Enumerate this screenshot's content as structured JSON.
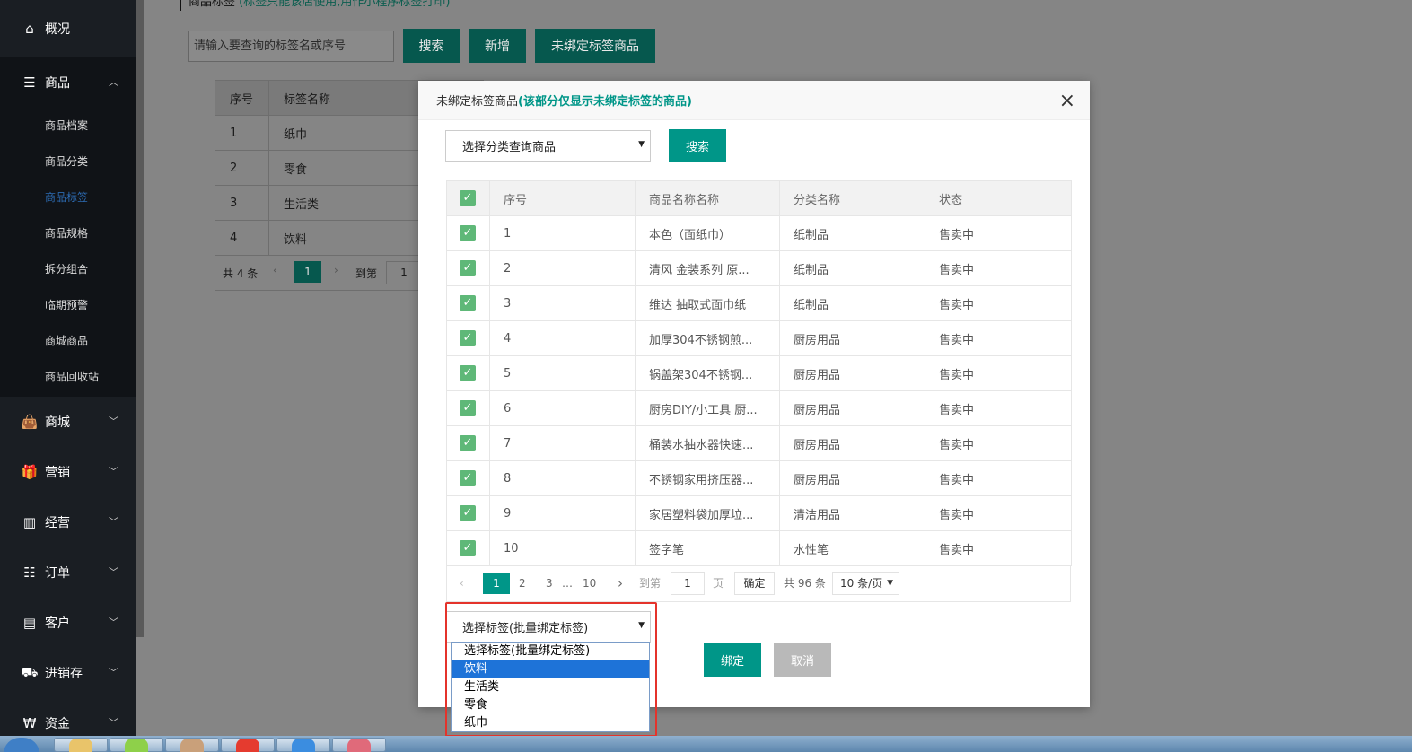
{
  "sidebar": {
    "top": {
      "label": "概况",
      "icon": "home-icon"
    },
    "product": {
      "label": "商品",
      "icon": "menu-icon"
    },
    "product_sub": [
      "商品档案",
      "商品分类",
      "商品标签",
      "商品规格",
      "拆分组合",
      "临期预警",
      "商城商品",
      "商品回收站"
    ],
    "active_sub_index": 2,
    "groups": [
      {
        "label": "商城",
        "icon": "shopping-bag-icon"
      },
      {
        "label": "营销",
        "icon": "gift-icon"
      },
      {
        "label": "经营",
        "icon": "bar-chart-icon"
      },
      {
        "label": "订单",
        "icon": "list-icon"
      },
      {
        "label": "客户",
        "icon": "id-card-icon"
      },
      {
        "label": "进销存",
        "icon": "truck-icon"
      },
      {
        "label": "资金",
        "icon": "won-icon"
      }
    ]
  },
  "page": {
    "title": "商品标签",
    "title_note": "(标签只能该店使用,用作小程序标签打印)",
    "search_placeholder": "请输入要查询的标签名或序号",
    "buttons": {
      "search": "搜索",
      "add": "新增",
      "unbound": "未绑定标签商品"
    },
    "table": {
      "headers": [
        "序号",
        "标签名称"
      ],
      "rows": [
        [
          "1",
          "纸巾"
        ],
        [
          "2",
          "零食"
        ],
        [
          "3",
          "生活类"
        ],
        [
          "4",
          "饮料"
        ]
      ]
    },
    "pager": {
      "total": "共 4 条",
      "current": "1",
      "goto": "到第",
      "goto_value": "1"
    }
  },
  "modal": {
    "title": "未绑定标签商品",
    "title_note": "(该部分仅显示未绑定标签的商品)",
    "category_select": "选择分类查询商品",
    "search": "搜索",
    "table": {
      "headers": [
        "序号",
        "商品名称名称",
        "分类名称",
        "状态"
      ],
      "rows": [
        [
          "1",
          "本色（面纸巾）",
          "纸制品",
          "售卖中"
        ],
        [
          "2",
          "清风 金装系列 原...",
          "纸制品",
          "售卖中"
        ],
        [
          "3",
          "维达 抽取式面巾纸",
          "纸制品",
          "售卖中"
        ],
        [
          "4",
          "加厚304不锈钢煎...",
          "厨房用品",
          "售卖中"
        ],
        [
          "5",
          "锅盖架304不锈钢...",
          "厨房用品",
          "售卖中"
        ],
        [
          "6",
          "厨房DIY/小工具 厨...",
          "厨房用品",
          "售卖中"
        ],
        [
          "7",
          "桶装水抽水器快速...",
          "厨房用品",
          "售卖中"
        ],
        [
          "8",
          "不锈钢家用挤压器...",
          "厨房用品",
          "售卖中"
        ],
        [
          "9",
          "家居塑料袋加厚垃...",
          "清洁用品",
          "售卖中"
        ],
        [
          "10",
          "签字笔",
          "水性笔",
          "售卖中"
        ]
      ]
    },
    "pager": {
      "prev": "‹",
      "current": "1",
      "p2": "2",
      "p3": "3",
      "ellipsis": "…",
      "last": "10",
      "next": "›",
      "goto": "到第",
      "goto_value": "1",
      "page_unit": "页",
      "confirm": "确定",
      "total": "共 96 条",
      "per_page": "10 条/页"
    },
    "tag_select": "选择标签(批量绑定标签)",
    "tag_options": [
      "选择标签(批量绑定标签)",
      "饮料",
      "生活类",
      "零食",
      "纸巾"
    ],
    "tag_selected_index": 1,
    "bind": "绑定",
    "cancel": "取消",
    "close": "×"
  },
  "colors": {
    "accent": "#009688",
    "check": "#5fb878",
    "sidebar": "#1a1e23",
    "highlight": "#e4332b",
    "selected_option": "#1e73d8"
  }
}
